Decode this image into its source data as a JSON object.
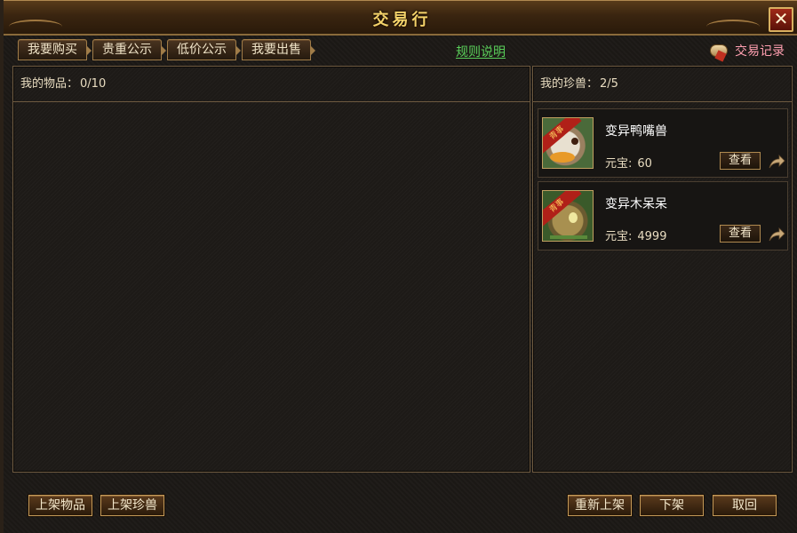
{
  "window": {
    "title": "交易行",
    "close_label": "✕"
  },
  "tabs": [
    {
      "label": "我要购买"
    },
    {
      "label": "贵重公示"
    },
    {
      "label": "低价公示"
    },
    {
      "label": "我要出售"
    }
  ],
  "rules_link": "规则说明",
  "trade_log": "交易记录",
  "left_panel": {
    "label": "我的物品：",
    "count": "0/10"
  },
  "right_panel": {
    "label": "我的珍兽：",
    "count": "2/5",
    "pets": [
      {
        "name": "变异鸭嘴兽",
        "price_label": "元宝:",
        "price": "60",
        "view_label": "查看",
        "badge": "青事"
      },
      {
        "name": "变异木呆呆",
        "price_label": "元宝:",
        "price": "4999",
        "view_label": "查看",
        "badge": "青事"
      }
    ]
  },
  "bottom": {
    "list_item": "上架物品",
    "list_pet": "上架珍兽",
    "relist": "重新上架",
    "delist": "下架",
    "retrieve": "取回"
  }
}
